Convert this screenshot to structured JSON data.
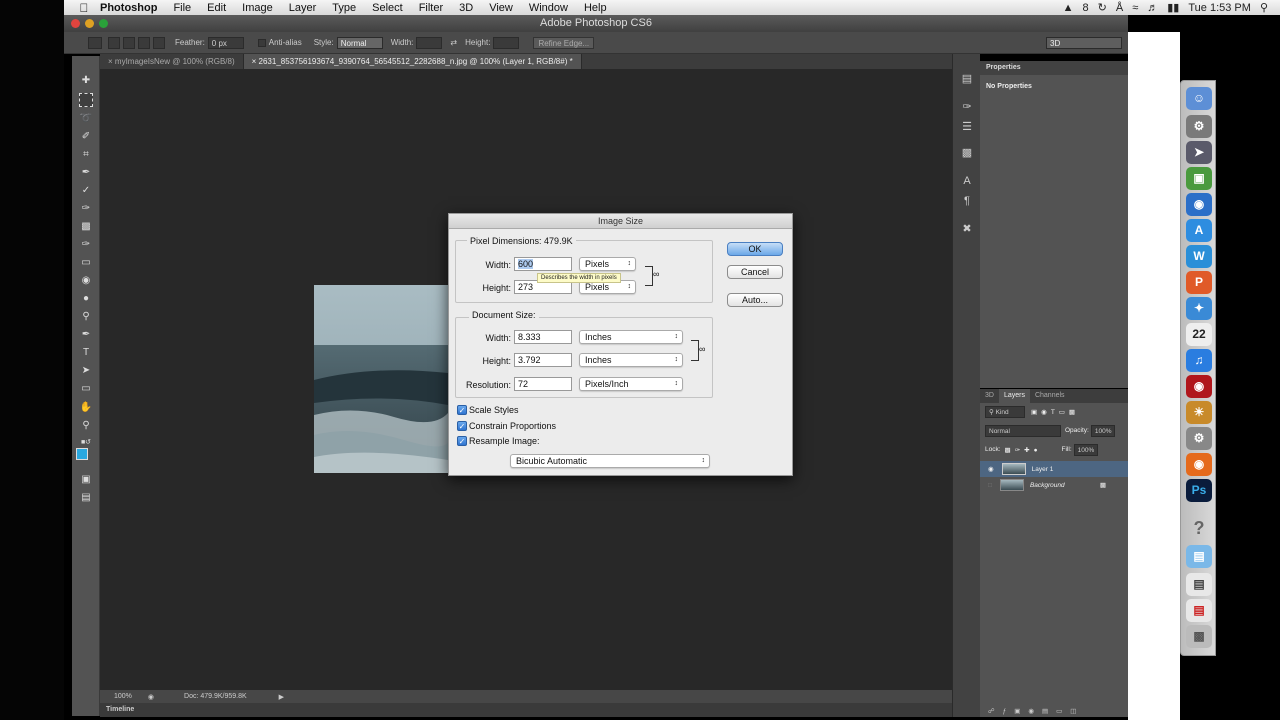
{
  "menubar": {
    "app_name": "Photoshop",
    "menus": [
      "File",
      "Edit",
      "Image",
      "Layer",
      "Type",
      "Select",
      "Filter",
      "3D",
      "View",
      "Window",
      "Help"
    ],
    "battery_count": "8",
    "clock": "Tue 1:53 PM"
  },
  "window": {
    "title": "Adobe Photoshop CS6"
  },
  "options_bar": {
    "feather_label": "Feather:",
    "feather_value": "0 px",
    "antialias_label": "Anti-alias",
    "style_label": "Style:",
    "style_value": "Normal",
    "width_label": "Width:",
    "height_label": "Height:",
    "refine_edge": "Refine Edge...",
    "workspace": "3D"
  },
  "tabs": [
    {
      "label": "myImageIsNew @ 100% (RGB/8)"
    },
    {
      "label": "2631_853756193674_9390764_56545512_2282688_n.jpg @ 100% (Layer 1, RGB/8#) *"
    }
  ],
  "status": {
    "zoom": "100%",
    "doc": "Doc: 479.9K/959.8K"
  },
  "timeline": {
    "label": "Timeline"
  },
  "properties": {
    "tab": "Properties",
    "empty_text": "No Properties"
  },
  "layers_panel": {
    "tabs": [
      "3D",
      "Layers",
      "Channels"
    ],
    "kind": "Kind",
    "blend_mode": "Normal",
    "opacity_label": "Opacity:",
    "opacity_value": "100%",
    "lock_label": "Lock:",
    "fill_label": "Fill:",
    "fill_value": "100%",
    "layers": [
      {
        "name": "Layer 1",
        "selected": true
      },
      {
        "name": "Background",
        "selected": false
      }
    ]
  },
  "dialog": {
    "title": "Image Size",
    "pixel_dimensions": {
      "label": "Pixel Dimensions:",
      "size": "479.9K",
      "width_label": "Width:",
      "width_value": "600",
      "width_unit": "Pixels",
      "height_label": "Height:",
      "height_value": "273",
      "height_unit": "Pixels"
    },
    "tooltip": "Describes the width in pixels",
    "document_size": {
      "label": "Document Size:",
      "width_label": "Width:",
      "width_value": "8.333",
      "width_unit": "Inches",
      "height_label": "Height:",
      "height_value": "3.792",
      "height_unit": "Inches",
      "resolution_label": "Resolution:",
      "resolution_value": "72",
      "resolution_unit": "Pixels/Inch"
    },
    "checkboxes": [
      {
        "label": "Scale Styles",
        "checked": true
      },
      {
        "label": "Constrain Proportions",
        "checked": true
      },
      {
        "label": "Resample Image:",
        "checked": true
      }
    ],
    "resample_method": "Bicubic Automatic",
    "buttons": {
      "ok": "OK",
      "cancel": "Cancel",
      "auto": "Auto..."
    }
  },
  "dock": {
    "calendar_day": "22",
    "ps_label": "Ps"
  }
}
